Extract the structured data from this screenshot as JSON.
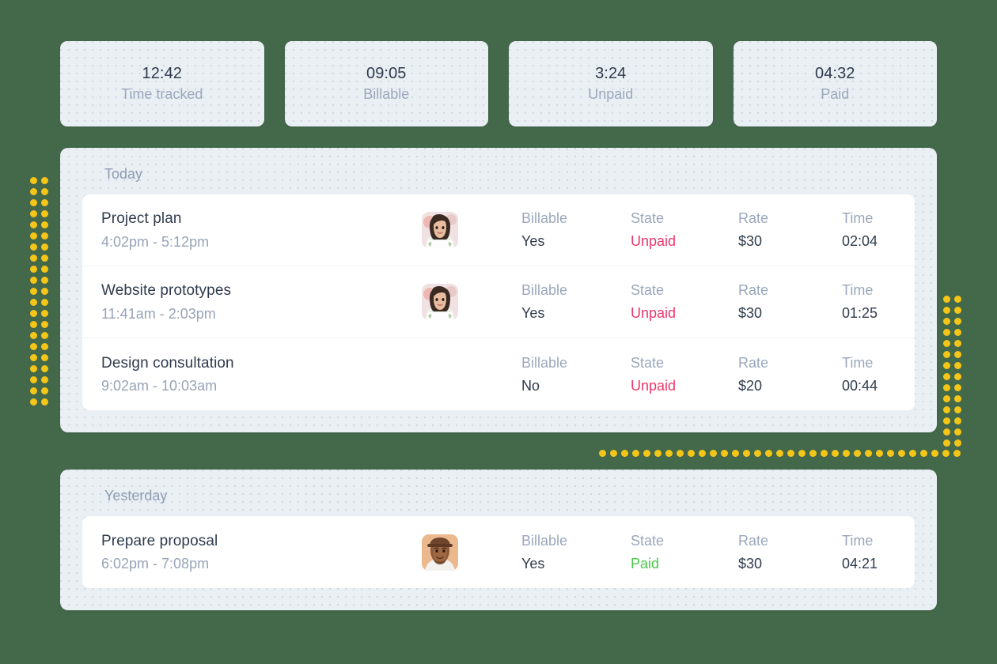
{
  "theme": {
    "page_background": "#44694a",
    "card_background": "#eaeff4",
    "row_background": "#ffffff",
    "dot_accent": "#f5c518",
    "text_primary": "#2f3b4c",
    "text_muted": "#9aa7bb",
    "state_unpaid": "#f0376a",
    "state_paid": "#48c949"
  },
  "stats": [
    {
      "value": "12:42",
      "label": "Time tracked"
    },
    {
      "value": "09:05",
      "label": "Billable"
    },
    {
      "value": "3:24",
      "label": "Unpaid"
    },
    {
      "value": "04:32",
      "label": "Paid"
    }
  ],
  "field_labels": {
    "billable": "Billable",
    "state": "State",
    "rate": "Rate",
    "time": "Time"
  },
  "groups": [
    {
      "title": "Today",
      "entries": [
        {
          "title": "Project plan",
          "time_range": "4:02pm - 5:12pm",
          "avatar": "woman-avatar",
          "billable": "Yes",
          "state": "Unpaid",
          "state_kind": "unpaid",
          "rate": "$30",
          "time": "02:04"
        },
        {
          "title": "Website prototypes",
          "time_range": "11:41am - 2:03pm",
          "avatar": "woman-avatar",
          "billable": "Yes",
          "state": "Unpaid",
          "state_kind": "unpaid",
          "rate": "$30",
          "time": "01:25"
        },
        {
          "title": "Design consultation",
          "time_range": "9:02am - 10:03am",
          "avatar": "",
          "billable": "No",
          "state": "Unpaid",
          "state_kind": "unpaid",
          "rate": "$20",
          "time": "00:44"
        }
      ]
    },
    {
      "title": "Yesterday",
      "entries": [
        {
          "title": "Prepare proposal",
          "time_range": "6:02pm - 7:08pm",
          "avatar": "man-avatar",
          "billable": "Yes",
          "state": "Paid",
          "state_kind": "paid",
          "rate": "$30",
          "time": "04:21"
        }
      ]
    }
  ],
  "decorations": {
    "dots_left": {
      "columns": 2,
      "rows": 21,
      "pitch": 14,
      "size": 9
    },
    "dots_right": {
      "columns": 2,
      "rows": 14,
      "pitch": 14,
      "size": 9
    },
    "dots_bottom": {
      "columns": 33,
      "rows": 1,
      "pitch": 14,
      "size": 9
    }
  }
}
